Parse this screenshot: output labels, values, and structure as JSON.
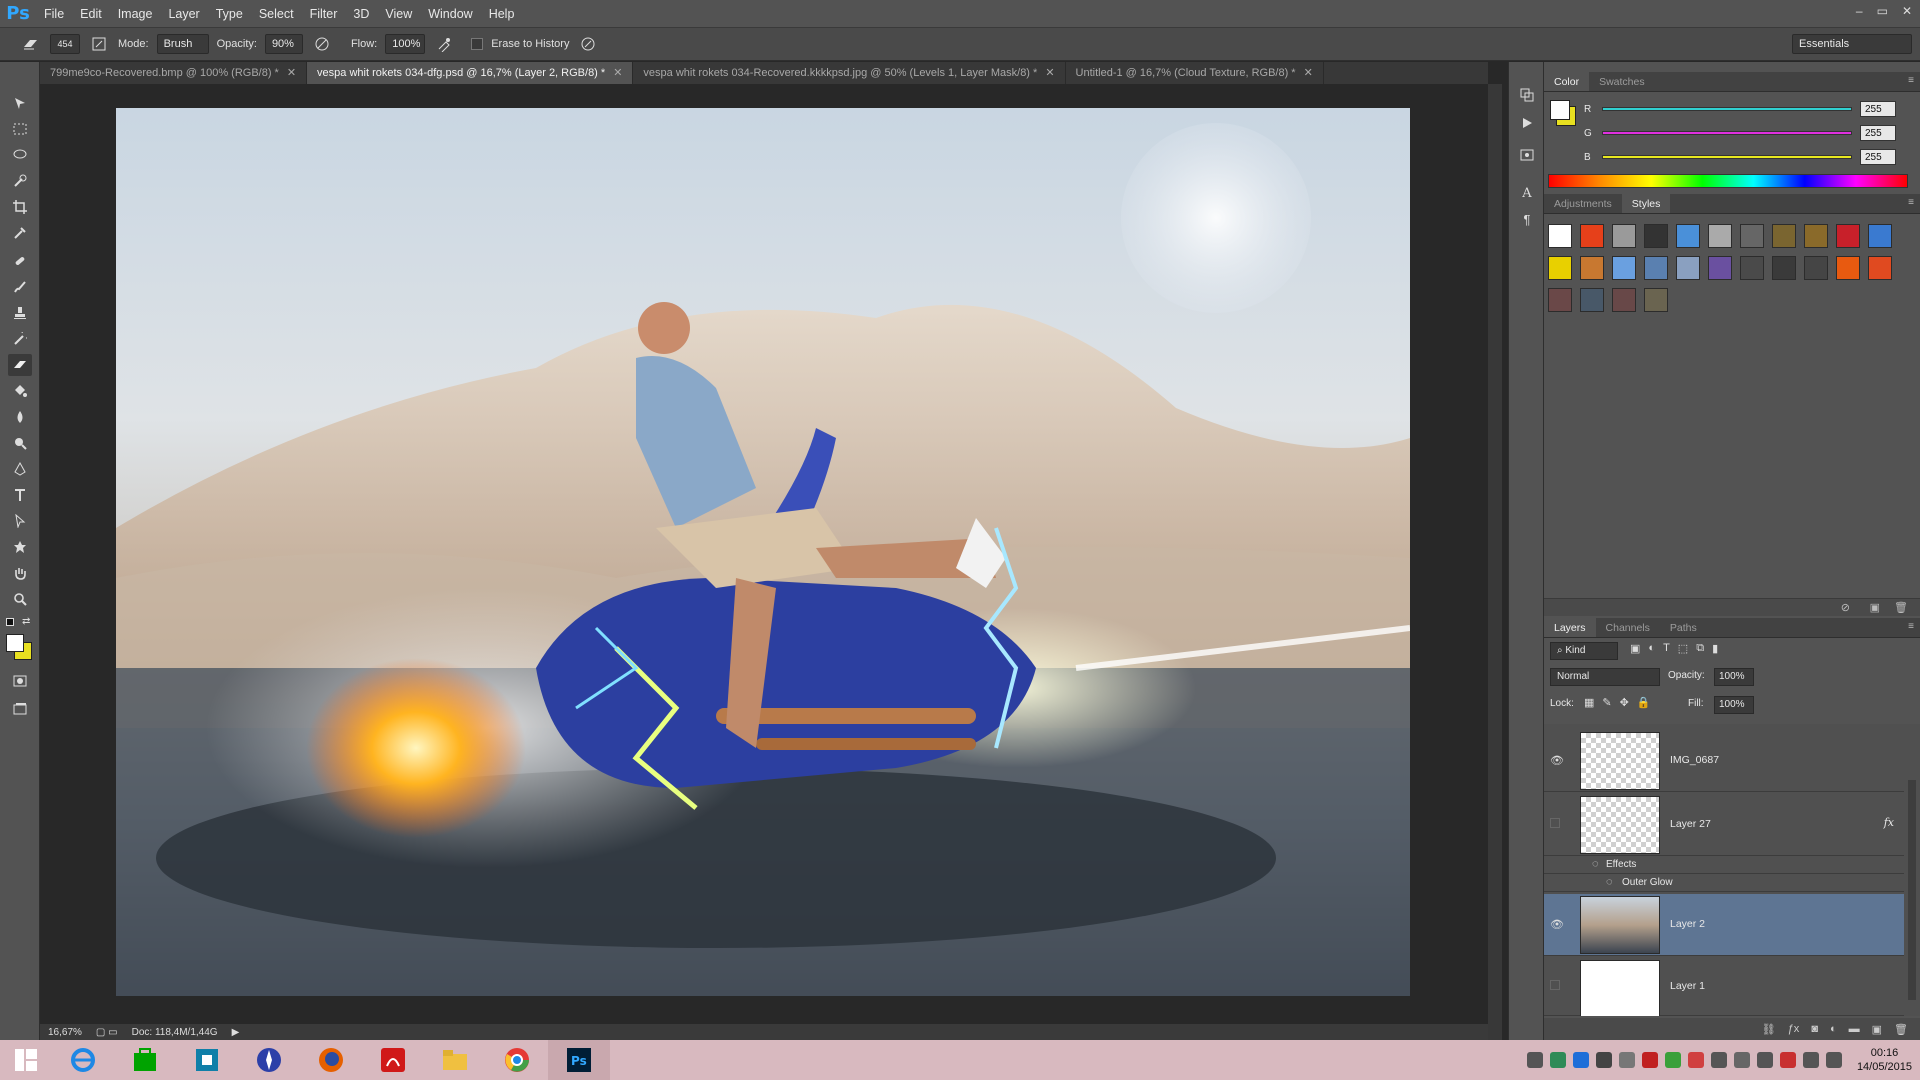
{
  "app": {
    "logo": "Ps"
  },
  "menu": [
    "File",
    "Edit",
    "Image",
    "Layer",
    "Type",
    "Select",
    "Filter",
    "3D",
    "View",
    "Window",
    "Help"
  ],
  "window_controls": {
    "minimize": "–",
    "restore": "▭",
    "close": "✕"
  },
  "options": {
    "brush_size": "454",
    "mode_label": "Mode:",
    "mode_value": "Brush",
    "opacity_label": "Opacity:",
    "opacity_value": "90%",
    "flow_label": "Flow:",
    "flow_value": "100%",
    "erase_label": "Erase to History",
    "workspace": "Essentials"
  },
  "tabs": [
    {
      "label": "799me9co-Recovered.bmp @ 100% (RGB/8) *",
      "close": "✕"
    },
    {
      "label": "vespa whit rokets 034-dfg.psd @ 16,7% (Layer 2, RGB/8) *",
      "close": "✕"
    },
    {
      "label": "vespa whit rokets 034-Recovered.kkkkpsd.jpg @ 50% (Levels 1, Layer Mask/8) *",
      "close": "✕"
    },
    {
      "label": "Untitled-1 @ 16,7% (Cloud Texture, RGB/8) *",
      "close": "✕"
    }
  ],
  "active_tab": 1,
  "status": {
    "zoom": "16,67%",
    "doc": "Doc: 118,4M/1,44G"
  },
  "color_panel": {
    "tabs": [
      "Color",
      "Swatches"
    ],
    "channels": [
      {
        "label": "R",
        "value": "255",
        "color": "#30d0d0"
      },
      {
        "label": "G",
        "value": "255",
        "color": "#e030e0"
      },
      {
        "label": "B",
        "value": "255",
        "color": "#e8e820"
      }
    ]
  },
  "styles_panel": {
    "tabs": [
      "Adjustments",
      "Styles"
    ],
    "swatches": [
      "#ffffff",
      "#e6401a",
      "#9a9a9a",
      "#333333",
      "#4a90d9",
      "#aaaaaa",
      "#666666",
      "#7a6530",
      "#8a6a2a",
      "#c8202a",
      "#3a7ad0",
      "#e8d000",
      "#c87830",
      "#6aa0e0",
      "#5a80b0",
      "#8aa0c0",
      "#6a50a0",
      "#4a4a4a",
      "#3a3a3a",
      "#454545",
      "#e85a10",
      "#e04a20",
      "#6a4848",
      "#485868",
      "#684848",
      "#6a6450"
    ]
  },
  "layers_panel": {
    "tabs": [
      "Layers",
      "Channels",
      "Paths"
    ],
    "kind": "Kind",
    "blend_mode": "Normal",
    "opacity_label": "Opacity:",
    "opacity_value": "100%",
    "lock_label": "Lock:",
    "fill_label": "Fill:",
    "fill_value": "100%",
    "layers": [
      {
        "name": "IMG_0687",
        "visible": true
      },
      {
        "name": "Layer 27",
        "visible": false,
        "fx": "fx",
        "effects_label": "Effects",
        "effect": "Outer Glow"
      },
      {
        "name": "Layer 2",
        "visible": true,
        "selected": true
      },
      {
        "name": "Layer 1",
        "visible": false
      }
    ]
  },
  "taskbar": {
    "clock_time": "00:16",
    "clock_date": "14/05/2015"
  }
}
